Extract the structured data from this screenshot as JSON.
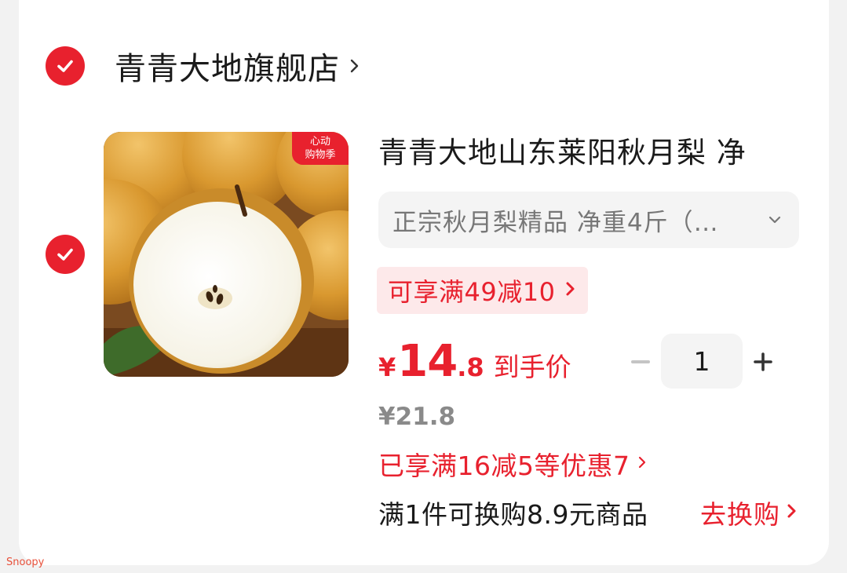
{
  "shop": {
    "name": "青青大地旗舰店",
    "selected": true
  },
  "item": {
    "selected": true,
    "promo_tag_line1": "心动",
    "promo_tag_line2": "购物季",
    "title": "青青大地山东莱阳秋月梨 净",
    "sku": "正宗秋月梨精品 净重4斤（…",
    "coupon": "可享满49减10",
    "price_symbol": "¥",
    "price_int": "14",
    "price_dec": ".8",
    "price_label": "到手价",
    "quantity": "1",
    "original_price": "¥21.8",
    "discount": "已享满16减5等优惠7",
    "exchange": "满1件可换购8.9元商品",
    "exchange_action": "去换购"
  },
  "watermark": "Snoopy",
  "colors": {
    "accent": "#e8212e",
    "coupon_bg": "#fde9ea",
    "muted": "#8a8a8a"
  },
  "icons": {
    "check": "check-icon",
    "chevron": "chevron-right-icon",
    "caret": "chevron-down-icon",
    "minus": "minus-icon",
    "plus": "plus-icon"
  }
}
